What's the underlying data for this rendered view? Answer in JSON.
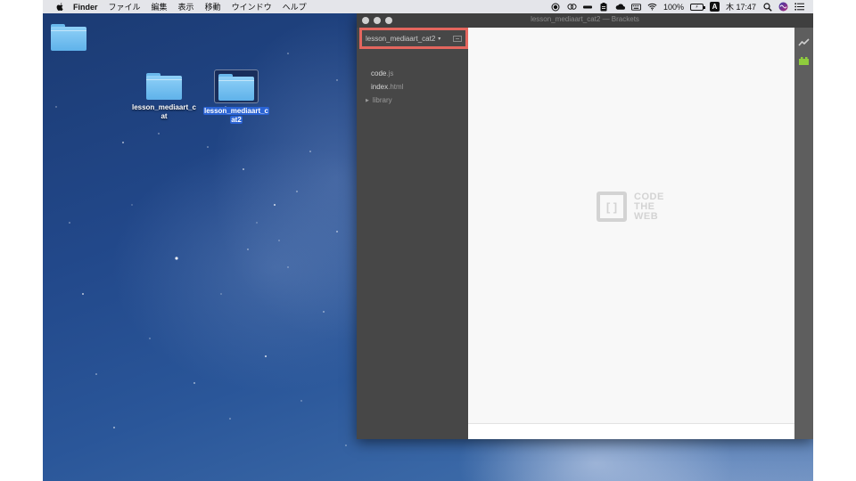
{
  "menubar": {
    "app_name": "Finder",
    "items": [
      "ファイル",
      "編集",
      "表示",
      "移動",
      "ウインドウ",
      "ヘルプ"
    ],
    "battery_percent": "100%",
    "input_method": "A",
    "clock": "木 17:47",
    "icons": [
      "apple-icon",
      "record-icon",
      "creative-cloud-icon",
      "minus-icon",
      "clipboard-icon",
      "cloud-icon",
      "keyboard-icon",
      "wifi-icon",
      "battery-icon",
      "search-icon",
      "siri-icon",
      "control-list-icon"
    ]
  },
  "desktop": {
    "folders": [
      {
        "label": ""
      },
      {
        "label_line1": "lesson_mediaart_c",
        "label_line2": "at"
      },
      {
        "label_line1": "lesson_mediaart_c",
        "label_line2": "at2",
        "selected": true
      }
    ]
  },
  "brackets": {
    "window_title": "lesson_mediaart_cat2 — Brackets",
    "project_name": "lesson_mediaart_cat2",
    "files": [
      {
        "name": "code",
        "ext": ".js"
      },
      {
        "name": "index",
        "ext": ".html"
      }
    ],
    "folder": "library",
    "logo_line1": "CODE",
    "logo_line2": "THE",
    "logo_line3": "WEB",
    "logo_glyph": "[ ]"
  }
}
